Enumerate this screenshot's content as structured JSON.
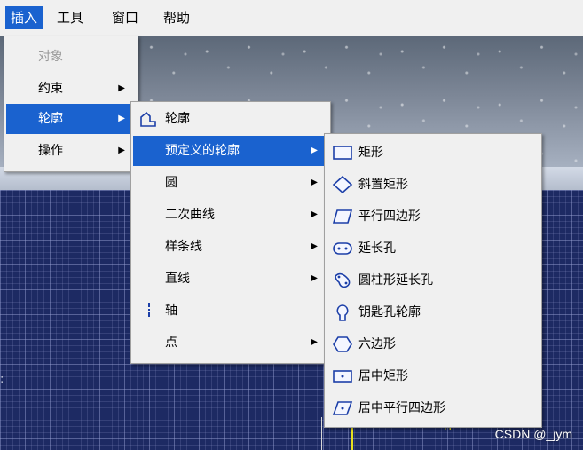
{
  "menubar": {
    "items": [
      "插入",
      "工具",
      "窗口",
      "帮助"
    ]
  },
  "insert_menu": {
    "items": [
      {
        "label": "对象",
        "disabled": true
      },
      {
        "label": "约束",
        "submenu": true
      },
      {
        "label": "轮廓",
        "submenu": true,
        "highlighted": true
      },
      {
        "label": "操作",
        "submenu": true
      }
    ]
  },
  "profile_menu": {
    "items": [
      {
        "label": "轮廓",
        "icon": "profile-icon"
      },
      {
        "label": "预定义的轮廓",
        "submenu": true,
        "highlighted": true
      },
      {
        "label": "圆",
        "submenu": true
      },
      {
        "label": "二次曲线",
        "submenu": true
      },
      {
        "label": "样条线",
        "submenu": true
      },
      {
        "label": "直线",
        "submenu": true
      },
      {
        "label": "轴",
        "icon": "axis-icon"
      },
      {
        "label": "点",
        "submenu": true
      }
    ]
  },
  "predefined_menu": {
    "items": [
      {
        "label": "矩形",
        "icon": "rectangle-icon"
      },
      {
        "label": "斜置矩形",
        "icon": "oriented-rectangle-icon"
      },
      {
        "label": "平行四边形",
        "icon": "parallelogram-icon"
      },
      {
        "label": "延长孔",
        "icon": "elongated-hole-icon"
      },
      {
        "label": "圆柱形延长孔",
        "icon": "cylindrical-elongated-hole-icon"
      },
      {
        "label": "钥匙孔轮廓",
        "icon": "keyhole-profile-icon"
      },
      {
        "label": "六边形",
        "icon": "hexagon-icon"
      },
      {
        "label": "居中矩形",
        "icon": "centered-rectangle-icon"
      },
      {
        "label": "居中平行四边形",
        "icon": "centered-parallelogram-icon"
      }
    ]
  },
  "watermark": "CSDN @_jym",
  "colors": {
    "highlight": "#1a62cf",
    "menu_bg": "#f0f0f0",
    "icon_blue": "#1c3fa8"
  }
}
